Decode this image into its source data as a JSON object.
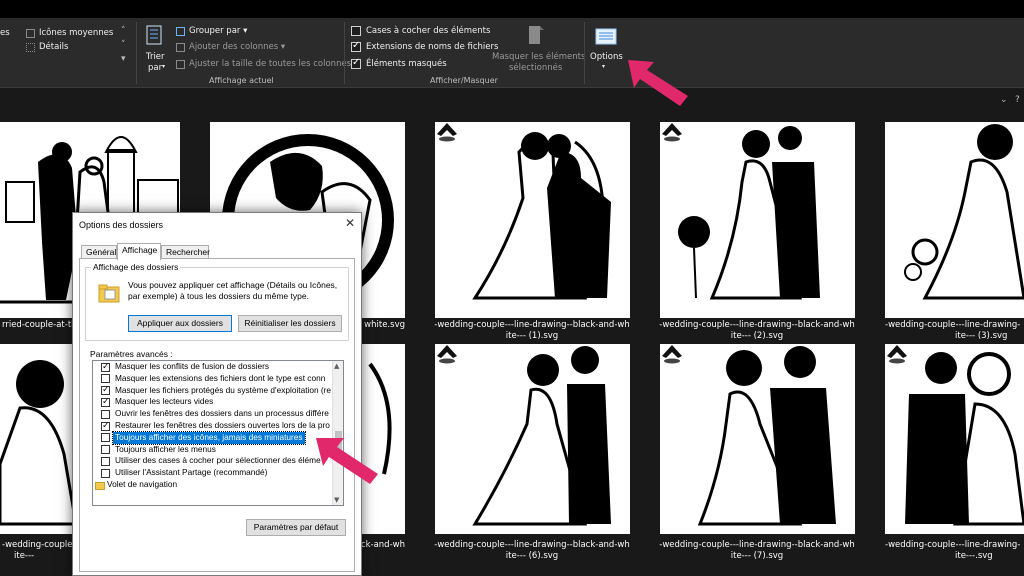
{
  "ribbon": {
    "view_items": [
      {
        "label": "es",
        "dim": false
      },
      {
        "label": "Icônes moyennes",
        "dim": false
      },
      {
        "label": "Détails",
        "dim": false
      }
    ],
    "sort_label_1": "Trier",
    "sort_label_2": "par",
    "group_by": "Grouper par",
    "add_columns": "Ajouter des colonnes",
    "fit_columns": "Ajuster la taille de toutes les colonnes",
    "current_view_label": "Affichage actuel",
    "item_checkboxes": "Cases à cocher des éléments",
    "file_extensions": "Extensions de noms de fichiers",
    "hidden_items": "Éléments masqués",
    "hide_selected_1": "Masquer les éléments",
    "hide_selected_2": "sélectionnés",
    "show_hide_label": "Afficher/Masquer",
    "options": "Options"
  },
  "thumbnails": {
    "row1": [
      {
        "caption_1": "rried-couple-at-th",
        "caption_2": ""
      },
      {
        "caption_1": "white.svg",
        "caption_2": ""
      },
      {
        "caption_1": "-wedding-couple---line-drawing--black-and-wh",
        "caption_2": "ite--- (1).svg"
      },
      {
        "caption_1": "-wedding-couple---line-drawing--black-and-wh",
        "caption_2": "ite--- (2).svg"
      },
      {
        "caption_1": "-wedding-couple---line-drawing-",
        "caption_2": "ite--- (3).svg"
      }
    ],
    "row2": [
      {
        "caption_1": "-wedding-couple---li",
        "caption_2": "ite---"
      },
      {
        "caption_1": "ack-and-wh",
        "caption_2": ""
      },
      {
        "caption_1": "-wedding-couple---line-drawing--black-and-wh",
        "caption_2": "ite--- (6).svg"
      },
      {
        "caption_1": "-wedding-couple---line-drawing--black-and-wh",
        "caption_2": "ite--- (7).svg"
      },
      {
        "caption_1": "-wedding-couple---line-drawing-",
        "caption_2": "ite---.svg"
      }
    ]
  },
  "dialog": {
    "title": "Options des dossiers",
    "close": "✕",
    "tabs": [
      "Général",
      "Affichage",
      "Rechercher"
    ],
    "folder_views_title": "Affichage des dossiers",
    "folder_views_desc": "Vous pouvez appliquer cet affichage (Détails ou Icônes, par exemple) à tous les dossiers du même type.",
    "apply_button": "Appliquer aux dossiers",
    "reset_button": "Réinitialiser les dossiers",
    "advanced_label": "Paramètres avancés :",
    "advanced_items": [
      {
        "label": "Masquer les conflits de fusion de dossiers",
        "checked": true
      },
      {
        "label": "Masquer les extensions des fichiers dont le type est conn",
        "checked": false
      },
      {
        "label": "Masquer les fichiers protégés du système d'exploitation (re",
        "checked": true
      },
      {
        "label": "Masquer les lecteurs vides",
        "checked": true
      },
      {
        "label": "Ouvrir les fenêtres des dossiers dans un processus différe",
        "checked": false
      },
      {
        "label": "Restaurer les fenêtres des dossiers ouvertes lors de la pro",
        "checked": true
      },
      {
        "label": "Toujours afficher des icônes, jamais des miniatures",
        "checked": false,
        "selected": true
      },
      {
        "label": "Toujours afficher les menus",
        "checked": false
      },
      {
        "label": "Utiliser des cases à cocher pour sélectionner des éléme",
        "checked": false
      },
      {
        "label": "Utiliser l'Assistant Partage (recommandé)",
        "checked": false
      },
      {
        "label": "Volet de navigation",
        "checked": false,
        "folder": true
      }
    ],
    "defaults_button": "Paramètres par défaut"
  },
  "colors": {
    "accent_arrow": "#e0286a",
    "selection": "#0078d7"
  }
}
